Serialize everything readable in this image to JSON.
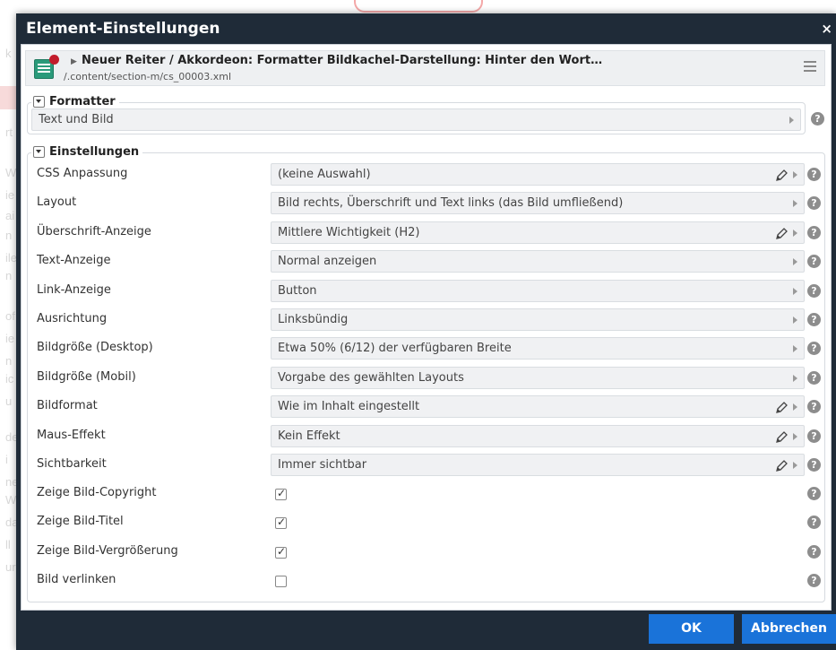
{
  "background": {
    "margin_letters": [
      "k",
      "rt",
      "W",
      "ie",
      "ai",
      "n",
      "ile",
      "n",
      "of",
      "ie",
      "n",
      "ic",
      "u",
      "de",
      "i",
      "ne",
      "W",
      "da",
      "ll",
      "ur"
    ]
  },
  "dialog": {
    "title": "Element-Einstellungen",
    "close_label": "×",
    "header": {
      "title": "Neuer Reiter / Akkordeon: Formatter Bildkachel-Darstellung: Hinter den Wort…",
      "path": "/.content/section-m/cs_00003.xml"
    },
    "formatter": {
      "legend": "Formatter",
      "selected": "Text und Bild"
    },
    "settings": {
      "legend": "Einstellungen",
      "rows": [
        {
          "label": "CSS Anpassung",
          "value": "(keine Auswahl)",
          "editable": true
        },
        {
          "label": "Layout",
          "value": "Bild rechts, Überschrift und Text links (das Bild umfließend)",
          "editable": false
        },
        {
          "label": "Überschrift-Anzeige",
          "value": "Mittlere Wichtigkeit (H2)",
          "editable": true
        },
        {
          "label": "Text-Anzeige",
          "value": "Normal anzeigen",
          "editable": false
        },
        {
          "label": "Link-Anzeige",
          "value": "Button",
          "editable": false
        },
        {
          "label": "Ausrichtung",
          "value": "Linksbündig",
          "editable": false
        },
        {
          "label": "Bildgröße (Desktop)",
          "value": "Etwa 50% (6/12) der verfügbaren Breite",
          "editable": false
        },
        {
          "label": "Bildgröße (Mobil)",
          "value": "Vorgabe des gewählten Layouts",
          "editable": false
        },
        {
          "label": "Bildformat",
          "value": "Wie im Inhalt eingestellt",
          "editable": true
        },
        {
          "label": "Maus-Effekt",
          "value": "Kein Effekt",
          "editable": true
        },
        {
          "label": "Sichtbarkeit",
          "value": "Immer sichtbar",
          "editable": true
        }
      ],
      "checkboxes": [
        {
          "label": "Zeige Bild-Copyright",
          "checked": true
        },
        {
          "label": "Zeige Bild-Titel",
          "checked": true
        },
        {
          "label": "Zeige Bild-Vergrößerung",
          "checked": true
        },
        {
          "label": "Bild verlinken",
          "checked": false
        }
      ]
    },
    "help_glyph": "?",
    "buttons": {
      "ok": "OK",
      "cancel": "Abbrechen"
    }
  },
  "colors": {
    "dialog_frame": "#1f2b38",
    "primary_button": "#1a73d9",
    "select_bg": "#f0f1f3",
    "header_icon": "#2a9a7a",
    "header_badge": "#c21c2b"
  }
}
